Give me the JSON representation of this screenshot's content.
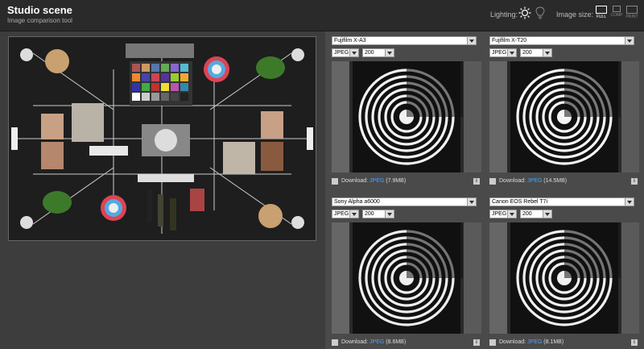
{
  "header": {
    "title": "Studio scene",
    "subtitle": "Image comparison tool",
    "lighting_label": "Lighting:",
    "image_size_label": "Image size:",
    "size_options": [
      "FULL",
      "COMP",
      "PRINT"
    ],
    "active_size": "FULL"
  },
  "cells": [
    {
      "camera": "Fujifilm X-A3",
      "format": "JPEG",
      "iso": "200",
      "download_label": "Download:",
      "download_format": "JPEG",
      "download_size": "(7.9MB)"
    },
    {
      "camera": "Fujifilm X-T20",
      "format": "JPEG",
      "iso": "200",
      "download_label": "Download:",
      "download_format": "JPEG",
      "download_size": "(14.5MB)"
    },
    {
      "camera": "Sony Alpha a6000",
      "format": "JPEG",
      "iso": "200",
      "download_label": "Download:",
      "download_format": "JPEG",
      "download_size": "(8.6MB)"
    },
    {
      "camera": "Canon EOS Rebel T7i",
      "format": "JPEG",
      "iso": "200",
      "download_label": "Download:",
      "download_format": "JPEG",
      "download_size": "(8.1MB)"
    }
  ],
  "colors": {
    "accent": "#4aa3ff",
    "topbar": "#2a2a2a",
    "panel": "#4a4a4a"
  },
  "icons": {
    "lighting_sun": "sun-icon",
    "lighting_bulb": "bulb-icon",
    "download": "download-icon",
    "info": "info-icon"
  }
}
